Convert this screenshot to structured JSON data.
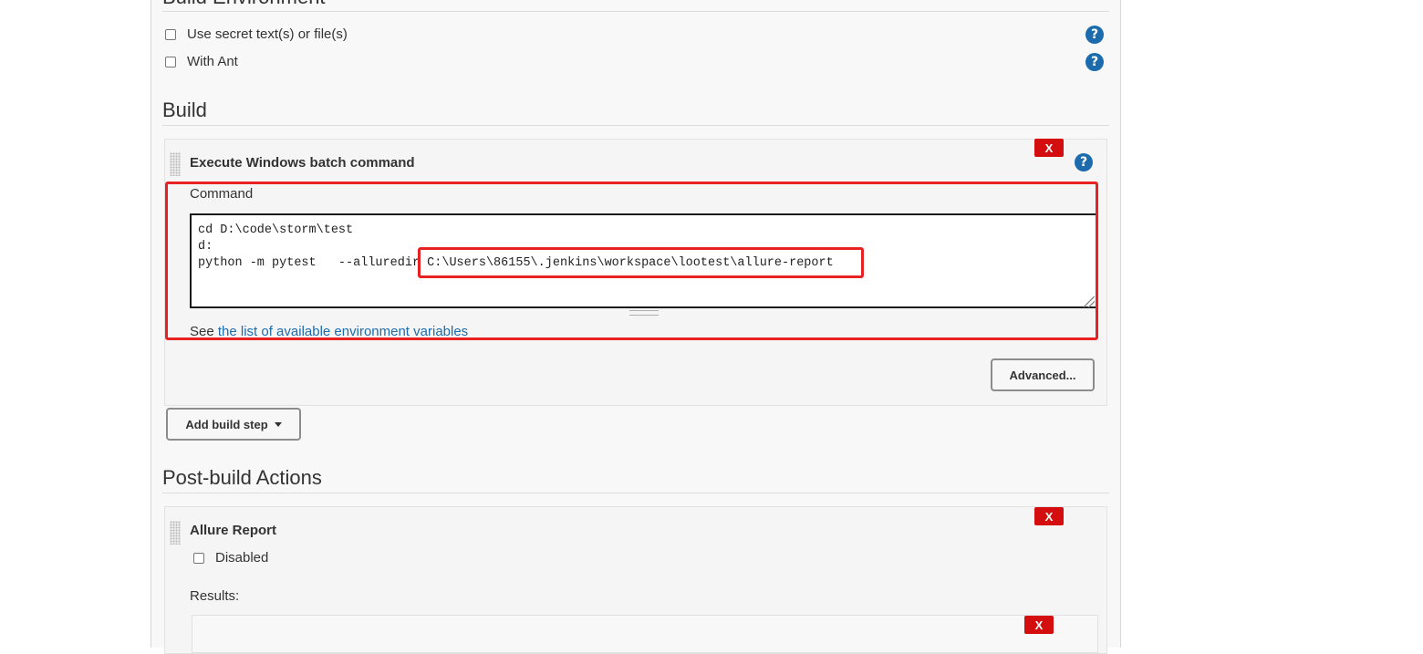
{
  "build_environment": {
    "title": "Build Environment",
    "options": [
      {
        "label": "Use secret text(s) or file(s)"
      },
      {
        "label": "With Ant"
      }
    ]
  },
  "build": {
    "title": "Build",
    "step_title": "Execute Windows batch command",
    "delete_label": "X",
    "command_label": "Command",
    "command_lines": [
      "cd D:\\code\\storm\\test",
      "d:",
      "python -m pytest   --alluredir C:\\Users\\86155\\.jenkins\\workspace\\lootest\\allure-report"
    ],
    "env_prefix": "See ",
    "env_link": "the list of available environment variables",
    "advanced_label": "Advanced...",
    "add_step_label": "Add build step"
  },
  "post_build": {
    "title": "Post-build Actions",
    "step_title": "Allure Report",
    "delete_label": "X",
    "disabled_label": "Disabled",
    "results_label": "Results:",
    "results_delete_label": "X"
  },
  "help_icon": "?",
  "colors": {
    "help_blue": "#1c6cad",
    "delete_red": "#d40e0e",
    "highlight_red": "#e82222",
    "link_blue": "#1c6cad"
  },
  "icons": [
    "help-icon",
    "drag-handle-icon",
    "caret-down-icon",
    "resize-icon"
  ]
}
